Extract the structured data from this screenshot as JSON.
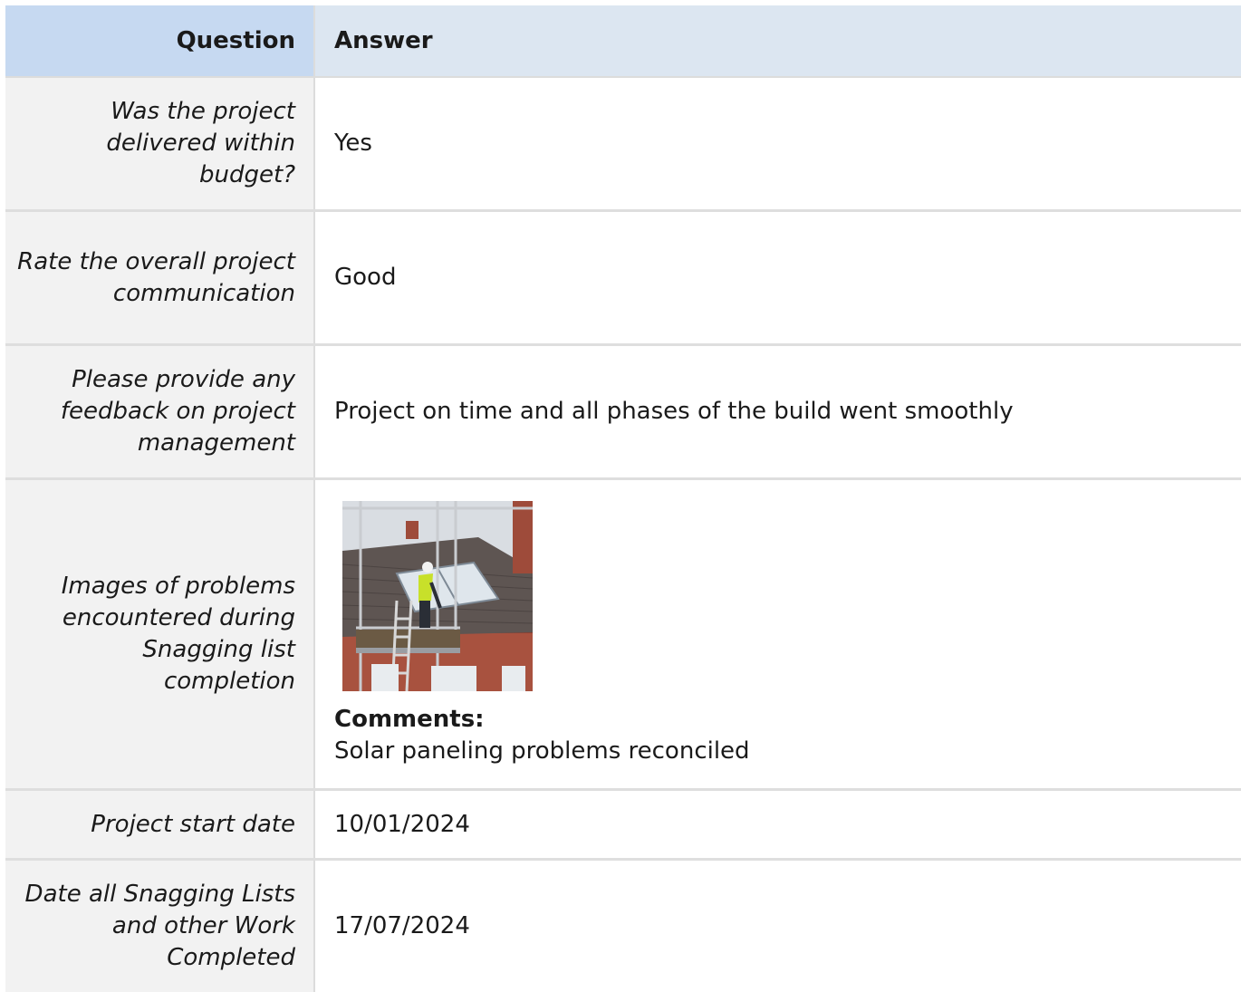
{
  "headers": {
    "question": "Question",
    "answer": "Answer"
  },
  "rows": [
    {
      "question": "Was the project delivered within budget?",
      "answer": "Yes"
    },
    {
      "question": "Rate the overall project communication",
      "answer": "Good"
    },
    {
      "question": "Please provide any feedback on project management",
      "answer": "Project on time and all phases of the build went smoothly"
    },
    {
      "question": "Images of problems encountered during Snagging list completion",
      "answer": "",
      "comments_label": "Comments:",
      "comments": "Solar paneling problems reconciled"
    },
    {
      "question": "Project start date",
      "answer": "10/01/2024"
    },
    {
      "question": "Date all Snagging Lists and other Work Completed",
      "answer": "17/07/2024"
    }
  ],
  "colors": {
    "header_question_bg": "#c6d9f1",
    "header_answer_bg": "#dce6f1",
    "question_cell_bg": "#f2f2f2"
  }
}
